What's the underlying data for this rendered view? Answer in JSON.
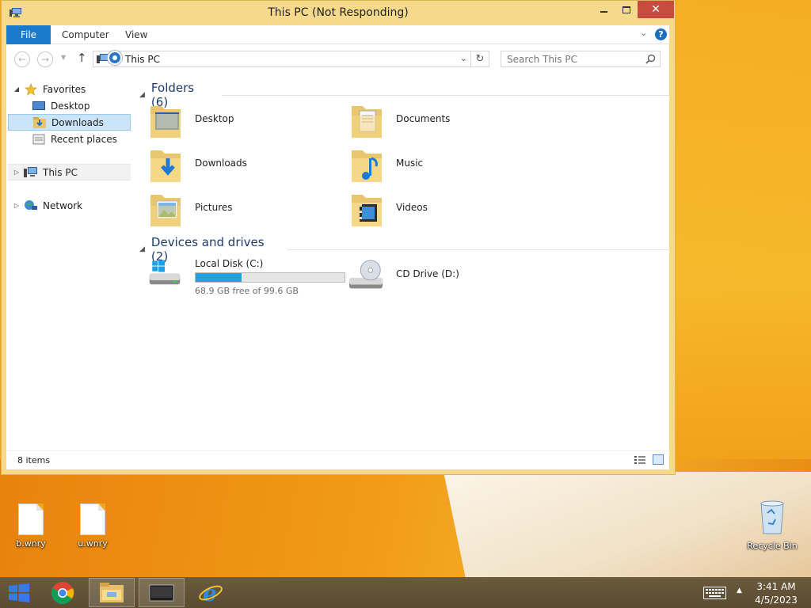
{
  "window": {
    "title": "This PC (Not Responding)",
    "close_glyph": "✕"
  },
  "ribbon": {
    "file_tab": "File",
    "tabs": [
      "Computer",
      "View"
    ]
  },
  "navbar": {
    "address": "This PC",
    "search_placeholder": "Search This PC"
  },
  "navpane": {
    "favorites": "Favorites",
    "favorite_items": [
      "Desktop",
      "Downloads",
      "Recent places"
    ],
    "selected_item": "Downloads",
    "this_pc": "This PC",
    "network": "Network"
  },
  "content": {
    "folders_header": "Folders (6)",
    "folders": [
      "Desktop",
      "Documents",
      "Downloads",
      "Music",
      "Pictures",
      "Videos"
    ],
    "devices_header": "Devices and drives (2)",
    "drives": [
      {
        "name": "Local Disk (C:)",
        "free_text": "68.9 GB free of 99.6 GB",
        "used_fraction": 0.308
      },
      {
        "name": "CD Drive (D:)"
      }
    ]
  },
  "statusbar": {
    "item_count": "8 items"
  },
  "desktop": {
    "icons": [
      "b.wnry",
      "u.wnry"
    ],
    "recycle_bin": "Recycle Bin"
  },
  "taskbar": {
    "time": "3:41 AM",
    "date": "4/5/2023"
  },
  "colors": {
    "accent": "#1979ca",
    "title_bar": "#f6d98b",
    "close_button": "#c74b3f",
    "drive_fill": "#26a0da",
    "selection": "#cce4f7"
  }
}
